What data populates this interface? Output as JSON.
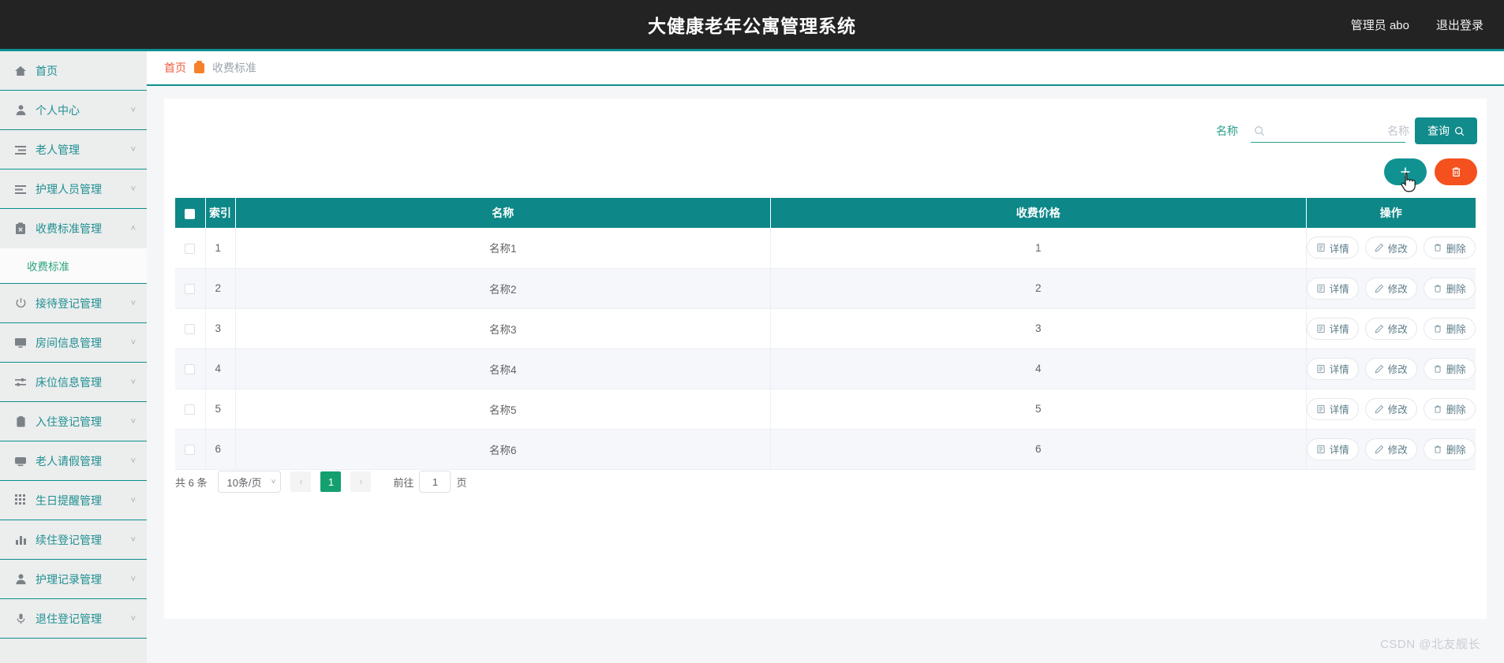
{
  "header": {
    "title": "大健康老年公寓管理系统",
    "user": "管理员 abo",
    "logout": "退出登录"
  },
  "sidebar": {
    "items": [
      {
        "label": "首页",
        "icon": "home-icon",
        "arrow": "",
        "expanded": false
      },
      {
        "label": "个人中心",
        "icon": "user-icon",
        "arrow": "˅",
        "expanded": false
      },
      {
        "label": "老人管理",
        "icon": "list-icon",
        "arrow": "˅",
        "expanded": false
      },
      {
        "label": "护理人员管理",
        "icon": "list-indent-icon",
        "arrow": "˅",
        "expanded": false
      },
      {
        "label": "收费标准管理",
        "icon": "clipboard-icon",
        "arrow": "˄",
        "expanded": true
      },
      {
        "label": "接待登记管理",
        "icon": "power-icon",
        "arrow": "˅",
        "expanded": false
      },
      {
        "label": "房间信息管理",
        "icon": "monitor-icon",
        "arrow": "˅",
        "expanded": false
      },
      {
        "label": "床位信息管理",
        "icon": "sliders-icon",
        "arrow": "˅",
        "expanded": false
      },
      {
        "label": "入住登记管理",
        "icon": "clipboard-icon",
        "arrow": "˅",
        "expanded": false
      },
      {
        "label": "老人请假管理",
        "icon": "tv-icon",
        "arrow": "˅",
        "expanded": false
      },
      {
        "label": "生日提醒管理",
        "icon": "grid-icon",
        "arrow": "˅",
        "expanded": false
      },
      {
        "label": "续住登记管理",
        "icon": "bar-chart-icon",
        "arrow": "˅",
        "expanded": false
      },
      {
        "label": "护理记录管理",
        "icon": "person-icon",
        "arrow": "˅",
        "expanded": false
      },
      {
        "label": "退住登记管理",
        "icon": "mic-icon",
        "arrow": "˅",
        "expanded": false
      }
    ],
    "submenu_label": "收费标准"
  },
  "breadcrumb": {
    "home": "首页",
    "current": "收费标准"
  },
  "search": {
    "label": "名称",
    "placeholder": "名称",
    "value": "",
    "button": "查询"
  },
  "actions": {
    "add": "+",
    "delete": "删除所选"
  },
  "table": {
    "columns": [
      "索引",
      "名称",
      "收费价格",
      "操作"
    ],
    "rows": [
      {
        "index": "1",
        "name": "名称1",
        "price": "1"
      },
      {
        "index": "2",
        "name": "名称2",
        "price": "2"
      },
      {
        "index": "3",
        "name": "名称3",
        "price": "3"
      },
      {
        "index": "4",
        "name": "名称4",
        "price": "4"
      },
      {
        "index": "5",
        "name": "名称5",
        "price": "5"
      },
      {
        "index": "6",
        "name": "名称6",
        "price": "6"
      }
    ],
    "ops": {
      "detail": "详情",
      "edit": "修改",
      "remove": "删除"
    }
  },
  "pagination": {
    "total": "共 6 条",
    "page_size": "10条/页",
    "prev": "‹",
    "next": "›",
    "current_page": "1",
    "goto_label": "前往",
    "goto_value": "1",
    "page_unit": "页"
  },
  "watermark": "CSDN @北友舰长",
  "colors": {
    "header_bg": "#232323",
    "primary": "#0d8787",
    "accent_orange": "#f4511e",
    "breadcrumb_home": "#f05a40",
    "page_active": "#13a06e"
  }
}
